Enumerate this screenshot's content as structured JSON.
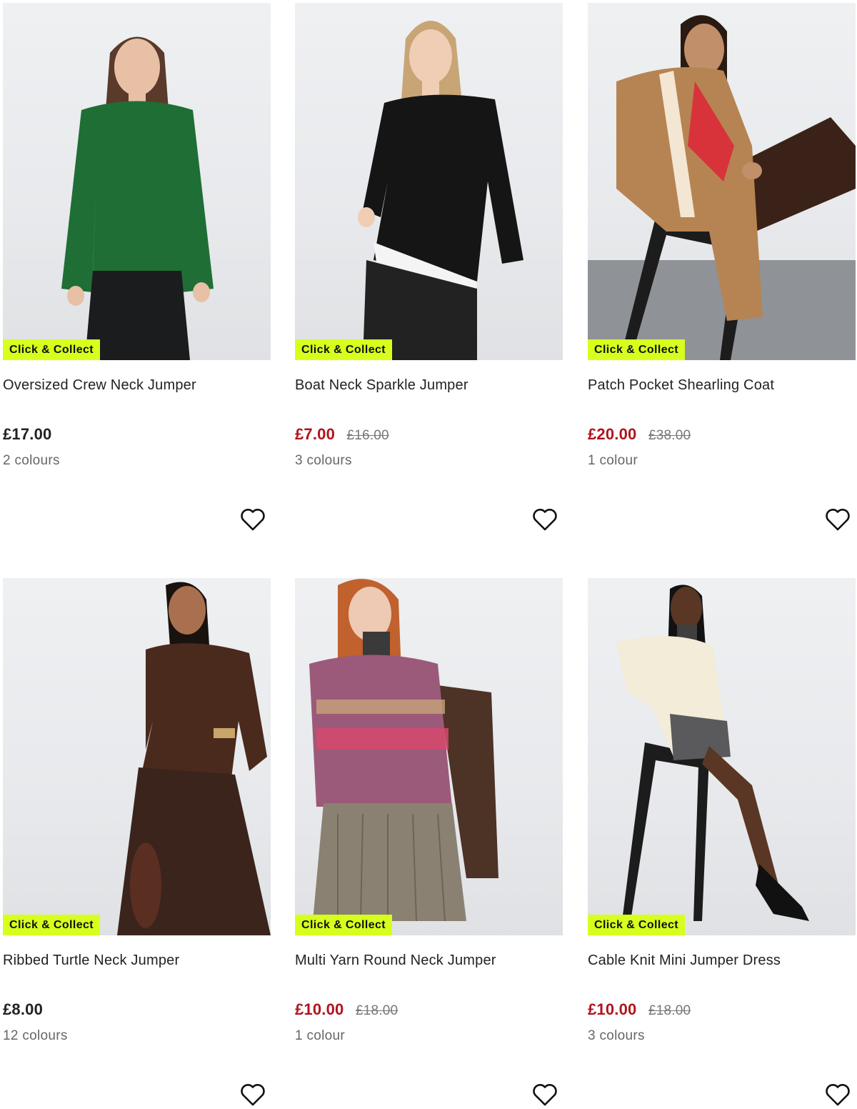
{
  "products": [
    {
      "badge": "Click & Collect",
      "name": "Oversized Crew Neck Jumper",
      "price": "£17.00",
      "was_price": "",
      "on_sale": false,
      "colours": "2 colours",
      "image_colors": {
        "top": "#1f6e35",
        "bottom": "#1b1c1e",
        "skin": "#e8c0a6",
        "hair": "#5a3a2a"
      }
    },
    {
      "badge": "Click & Collect",
      "name": "Boat Neck Sparkle Jumper",
      "price": "£7.00",
      "was_price": "£16.00",
      "on_sale": true,
      "colours": "3 colours",
      "image_colors": {
        "top": "#151515",
        "bottom": "#222222",
        "skin": "#f0cdb5",
        "hair": "#c8a575"
      }
    },
    {
      "badge": "Click & Collect",
      "name": "Patch Pocket Shearling Coat",
      "price": "£20.00",
      "was_price": "£38.00",
      "on_sale": true,
      "colours": "1 colour",
      "image_colors": {
        "top": "#b68452",
        "bottom": "#3b2218",
        "skin": "#c28f6b",
        "hair": "#2a1a12"
      }
    },
    {
      "badge": "Click & Collect",
      "name": "Ribbed Turtle Neck Jumper",
      "price": "£8.00",
      "was_price": "",
      "on_sale": false,
      "colours": "12 colours",
      "image_colors": {
        "top": "#4a2a1d",
        "bottom": "#3a241b",
        "skin": "#a8704f",
        "hair": "#1a120e"
      }
    },
    {
      "badge": "Click & Collect",
      "name": "Multi Yarn Round Neck Jumper",
      "price": "£10.00",
      "was_price": "£18.00",
      "on_sale": true,
      "colours": "1 colour",
      "image_colors": {
        "top": "#9c5a7a",
        "bottom": "#8a8172",
        "skin": "#eec9b3",
        "hair": "#c0612e"
      }
    },
    {
      "badge": "Click & Collect",
      "name": "Cable Knit Mini Jumper Dress",
      "price": "£10.00",
      "was_price": "£18.00",
      "on_sale": true,
      "colours": "3 colours",
      "image_colors": {
        "top": "#f2ecd8",
        "bottom": "#5a5a5c",
        "skin": "#5a3624",
        "hair": "#121212"
      }
    }
  ],
  "theme": {
    "badge_bg": "#d7ff1e",
    "sale_red": "#b0141c"
  }
}
